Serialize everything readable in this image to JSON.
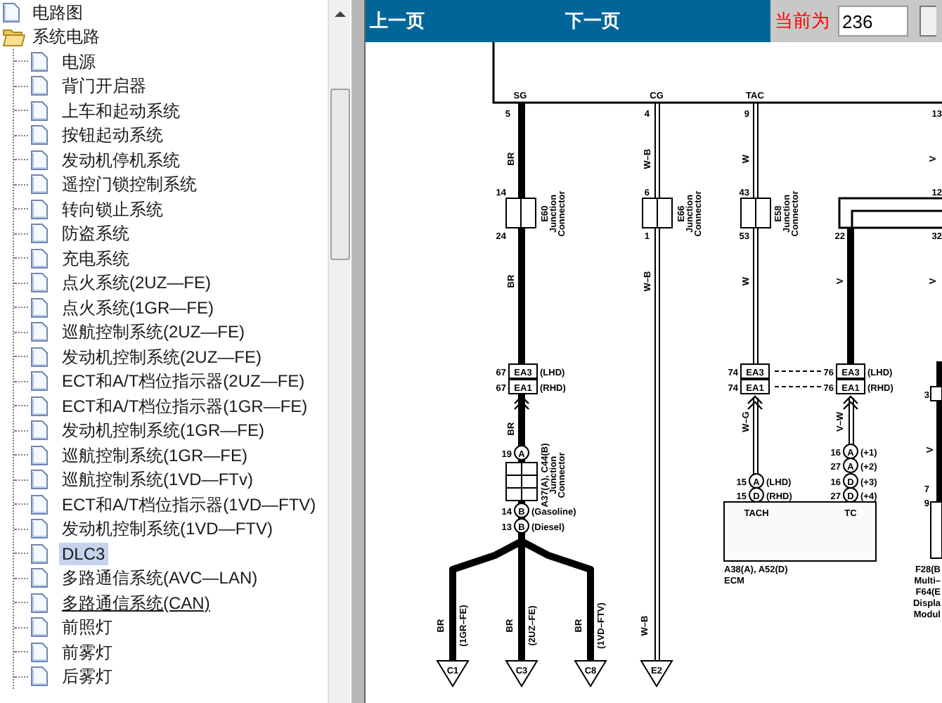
{
  "tree": [
    {
      "label": "电路图",
      "kind": "document",
      "selected": false,
      "hovered": false
    },
    {
      "label": "系统电路",
      "kind": "folder",
      "expanded": true,
      "selected": false,
      "hovered": false,
      "children": [
        {
          "label": "电源",
          "selected": false,
          "hovered": false
        },
        {
          "label": "背门开启器",
          "selected": false,
          "hovered": false
        },
        {
          "label": "上车和起动系统",
          "selected": false,
          "hovered": false
        },
        {
          "label": "按钮起动系统",
          "selected": false,
          "hovered": false
        },
        {
          "label": "发动机停机系统",
          "selected": false,
          "hovered": false
        },
        {
          "label": "遥控门锁控制系统",
          "selected": false,
          "hovered": false
        },
        {
          "label": "转向锁止系统",
          "selected": false,
          "hovered": false
        },
        {
          "label": "防盗系统",
          "selected": false,
          "hovered": false
        },
        {
          "label": "充电系统",
          "selected": false,
          "hovered": false
        },
        {
          "label": "点火系统(2UZ—FE)",
          "selected": false,
          "hovered": false
        },
        {
          "label": "点火系统(1GR—FE)",
          "selected": false,
          "hovered": false
        },
        {
          "label": "巡航控制系统(2UZ—FE)",
          "selected": false,
          "hovered": false
        },
        {
          "label": "发动机控制系统(2UZ—FE)",
          "selected": false,
          "hovered": false
        },
        {
          "label": "ECT和A/T档位指示器(2UZ—FE)",
          "selected": false,
          "hovered": false
        },
        {
          "label": "ECT和A/T档位指示器(1GR—FE)",
          "selected": false,
          "hovered": false
        },
        {
          "label": "发动机控制系统(1GR—FE)",
          "selected": false,
          "hovered": false
        },
        {
          "label": "巡航控制系统(1GR—FE)",
          "selected": false,
          "hovered": false
        },
        {
          "label": "巡航控制系统(1VD—FTv)",
          "selected": false,
          "hovered": false
        },
        {
          "label": "ECT和A/T档位指示器(1VD—FTV)",
          "selected": false,
          "hovered": false
        },
        {
          "label": "发动机控制系统(1VD—FTV)",
          "selected": false,
          "hovered": false
        },
        {
          "label": "DLC3",
          "selected": true,
          "hovered": false
        },
        {
          "label": "多路通信系统(AVC—LAN)",
          "selected": false,
          "hovered": false
        },
        {
          "label": "多路通信系统(CAN)",
          "selected": false,
          "hovered": true
        },
        {
          "label": "前照灯",
          "selected": false,
          "hovered": false
        },
        {
          "label": "前雾灯",
          "selected": false,
          "hovered": false
        },
        {
          "label": "后雾灯",
          "selected": false,
          "hovered": false
        }
      ]
    }
  ],
  "toolbar": {
    "prev": "上一页",
    "next": "下一页",
    "current_label": "当前为",
    "current_page": "236"
  },
  "diagram": {
    "labels": [
      "SG",
      "CG",
      "TAC",
      "5",
      "4",
      "9",
      "13",
      "BR",
      "W–B",
      "W",
      "V",
      "14",
      "6",
      "43",
      "12",
      "E60",
      "Junction",
      "Connector",
      "E66",
      "Junction",
      "Connector",
      "E58",
      "Junction",
      "Connector",
      "24",
      "1",
      "53",
      "22",
      "32",
      "BR",
      "W–B",
      "W",
      "V",
      "V",
      "67",
      "EA3",
      "(LHD)",
      "67",
      "EA1",
      "(RHD)",
      "74",
      "EA3",
      "74",
      "EA1",
      "76",
      "EA3",
      "(LHD)",
      "76",
      "EA1",
      "(RHD)",
      "BR",
      "W–G",
      "V–W",
      "19",
      "A",
      "A37(A), C44(B)",
      "Junction",
      "Connector",
      "14",
      "B",
      "(Gasoline)",
      "13",
      "B",
      "(Diesel)",
      "16",
      "A",
      "(+1)",
      "27",
      "A",
      "(+2)",
      "16",
      "D",
      "(+3)",
      "27",
      "D",
      "(+4)",
      "15",
      "A",
      "(LHD)",
      "15",
      "D",
      "(RHD)",
      "TACH",
      "TC",
      "A38(A), A52(D)",
      "ECM",
      "BR",
      "(1GR–FE)",
      "BR",
      "(2UZ–FE)",
      "BR",
      "(1VD–FTV)",
      "W–B",
      "C1",
      "C3",
      "C8",
      "E2",
      "3",
      "V",
      "7",
      "9",
      "F28(B",
      "Multi–",
      "F64(E",
      "Displa",
      "Modul"
    ]
  }
}
